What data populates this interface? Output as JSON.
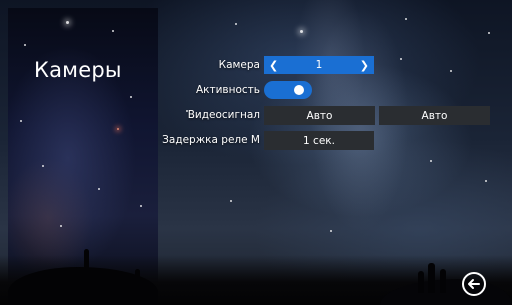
{
  "page": {
    "title": "Камеры"
  },
  "settings": {
    "camera": {
      "label": "Камера",
      "value": "1",
      "prev_icon": "chevron-left-icon",
      "next_icon": "chevron-right-icon"
    },
    "activity": {
      "label": "Активность",
      "enabled": true
    },
    "video_signal": {
      "label": "Видеосигнал",
      "value_1": "Авто",
      "value_2": "Авто"
    },
    "relay_delay": {
      "label": "Задержка реле М",
      "value": "1 сек."
    }
  },
  "navigation": {
    "back_icon": "back-arrow-icon"
  },
  "colors": {
    "accent": "#1a6fd3",
    "field_bg": "#2a2d31"
  }
}
